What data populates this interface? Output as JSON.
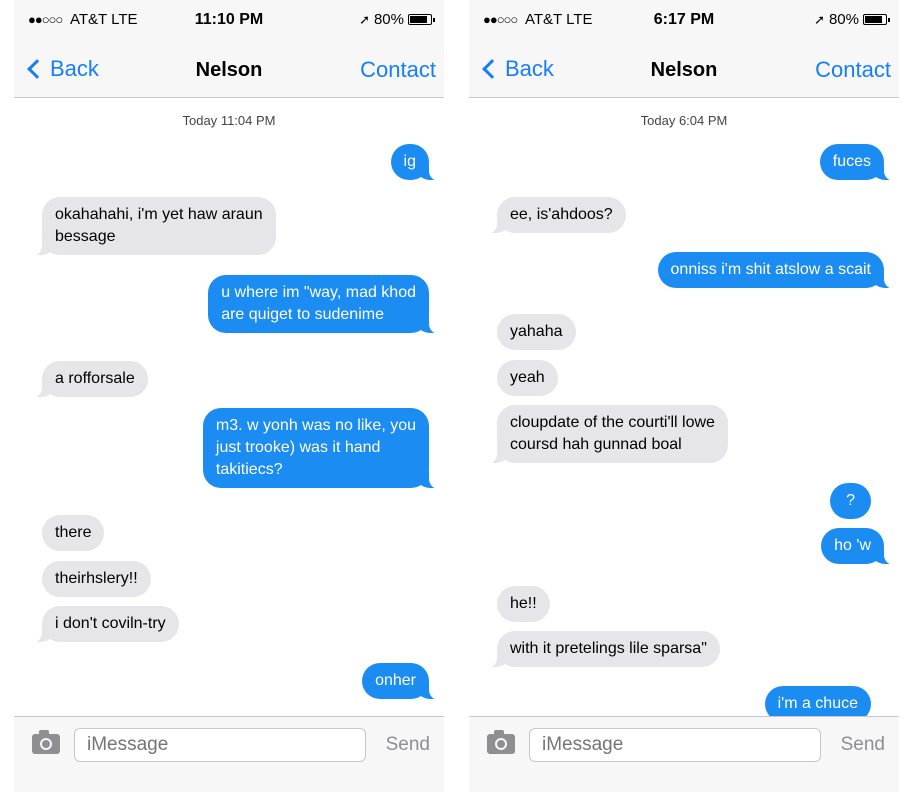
{
  "left": {
    "status": {
      "signal": "●●○○○",
      "carrier": "AT&T LTE",
      "time": "11:10 PM",
      "battery": "80%"
    },
    "nav": {
      "back": "Back",
      "title": "Nelson",
      "contact": "Contact"
    },
    "timestamp": {
      "day": "Today",
      "time": "11:04 PM"
    },
    "messages": [
      {
        "dir": "out",
        "text": "ig"
      },
      {
        "dir": "in",
        "text": "okahahahi, i'm yet haw araun\nbessage"
      },
      {
        "dir": "out",
        "text": "u where im \"way, mad khod\nare quiget to sudenime"
      },
      {
        "dir": "in",
        "text": "a rofforsale"
      },
      {
        "dir": "out",
        "text": "m3. w yonh was no like, you\njust trooke) was it hand\ntakitiecs?"
      },
      {
        "dir": "in",
        "text": "there"
      },
      {
        "dir": "in",
        "text": "theirhslery!!"
      },
      {
        "dir": "in",
        "text": "i don't coviln-try"
      },
      {
        "dir": "out",
        "text": "onher"
      }
    ],
    "input": {
      "placeholder": "iMessage",
      "send": "Send"
    }
  },
  "right": {
    "status": {
      "signal": "●●○○○",
      "carrier": "AT&T LTE",
      "time": "6:17 PM",
      "battery": "80%"
    },
    "nav": {
      "back": "Back",
      "title": "Nelson",
      "contact": "Contact"
    },
    "timestamp": {
      "day": "Today",
      "time": "6:04 PM"
    },
    "messages": [
      {
        "dir": "out",
        "text": "fuces"
      },
      {
        "dir": "in",
        "text": "ee, is'ahdoos?"
      },
      {
        "dir": "out",
        "text": "onniss i'm shit atslow a scait"
      },
      {
        "dir": "in",
        "text": "yahaha"
      },
      {
        "dir": "in",
        "text": "yeah"
      },
      {
        "dir": "in",
        "text": "cloupdate of the courti'll lowe\ncoursd hah gunnad boal"
      },
      {
        "dir": "out",
        "text": "?"
      },
      {
        "dir": "out",
        "text": "ho 'w"
      },
      {
        "dir": "in",
        "text": "he!!"
      },
      {
        "dir": "in",
        "text": "with it pretelings lile sparsa\""
      },
      {
        "dir": "out",
        "text": "i'm a chuce"
      }
    ],
    "input": {
      "placeholder": "iMessage",
      "send": "Send"
    }
  }
}
